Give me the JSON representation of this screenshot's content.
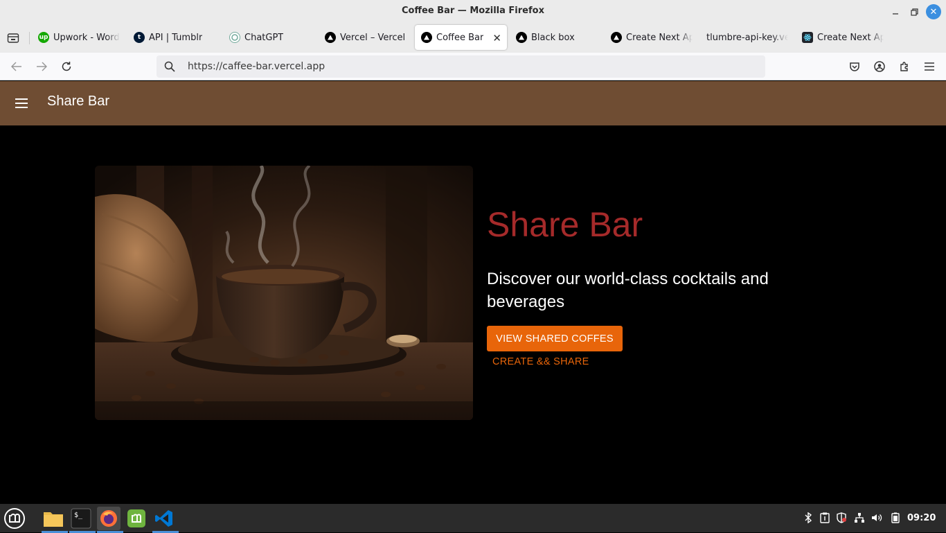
{
  "window": {
    "title": "Coffee Bar — Mozilla Firefox"
  },
  "tabs": [
    {
      "label": "Upwork - Wordp",
      "icon": "upwork-icon"
    },
    {
      "label": "API | Tumblr",
      "icon": "tumblr-icon"
    },
    {
      "label": "ChatGPT",
      "icon": "chatgpt-icon"
    },
    {
      "label": "Vercel – Vercel",
      "icon": "vercel-icon"
    },
    {
      "label": "Coffee Bar",
      "icon": "vercel-icon",
      "active": true
    },
    {
      "label": "Black box",
      "icon": "vercel-icon"
    },
    {
      "label": "Create Next App",
      "icon": "vercel-icon"
    },
    {
      "label": "tlumbre-api-key.ver",
      "icon": "none"
    },
    {
      "label": "Create Next App",
      "icon": "react-icon"
    }
  ],
  "address_bar": {
    "url": "https://caffee-bar.vercel.app"
  },
  "app": {
    "brand": "Share Bar",
    "hero": {
      "title": "Share Bar",
      "subtitle": "Discover our world-class cocktails and beverages",
      "primary_button": "VIEW SHARED COFFES",
      "secondary_button": "CREATE && SHARE"
    }
  },
  "colors": {
    "appbar": "#6f4d33",
    "accent": "#e8650a",
    "title": "#a52a2a"
  },
  "taskbar": {
    "apps": [
      "files-icon",
      "terminal-icon",
      "firefox-icon",
      "mintupdate-icon",
      "vscode-icon"
    ],
    "tray": [
      "bluetooth-icon",
      "clipboard-icon",
      "shield-icon",
      "network-icon",
      "volume-icon",
      "battery-icon"
    ],
    "clock": "09:20"
  }
}
